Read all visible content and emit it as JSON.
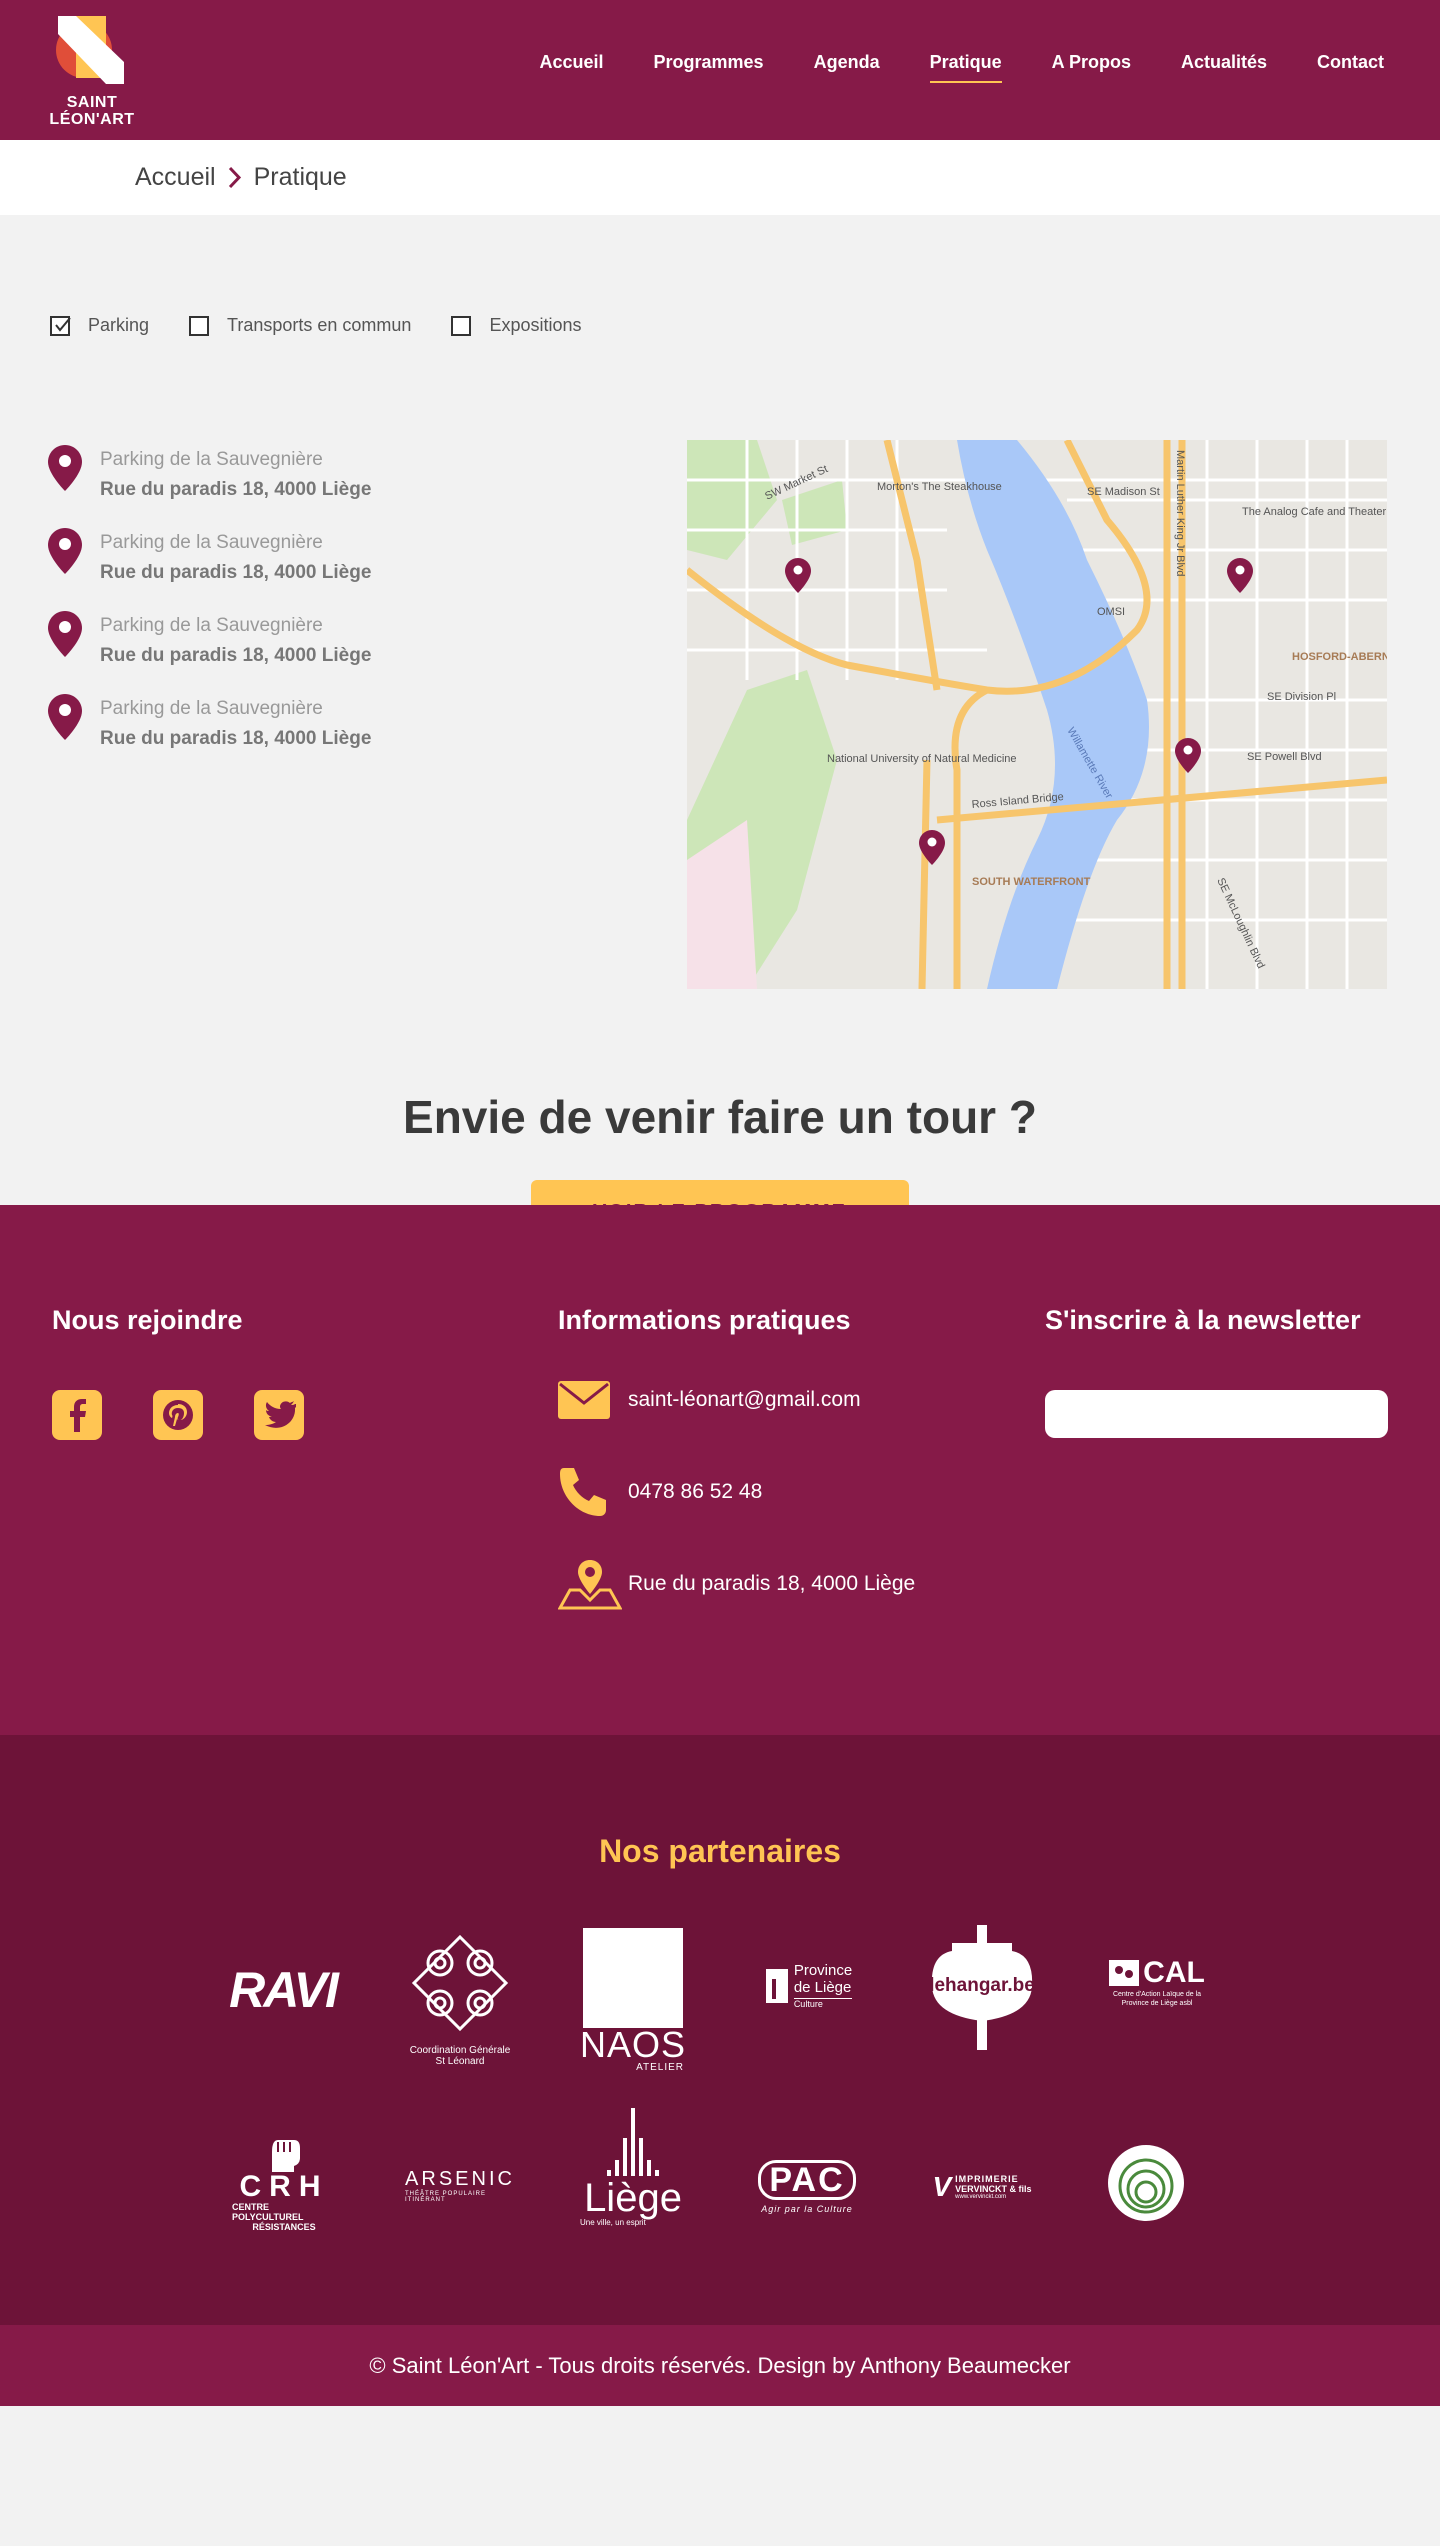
{
  "header": {
    "logo_text_line1": "SAINT",
    "logo_text_line2": "LÉON'ART",
    "nav": [
      {
        "label": "Accueil",
        "active": false
      },
      {
        "label": "Programmes",
        "active": false
      },
      {
        "label": "Agenda",
        "active": false
      },
      {
        "label": "Pratique",
        "active": true
      },
      {
        "label": "A Propos",
        "active": false
      },
      {
        "label": "Actualités",
        "active": false
      },
      {
        "label": "Contact",
        "active": false
      }
    ]
  },
  "breadcrumb": {
    "home": "Accueil",
    "current": "Pratique"
  },
  "filters": [
    {
      "label": "Parking",
      "checked": true
    },
    {
      "label": "Transports en commun",
      "checked": false
    },
    {
      "label": "Expositions",
      "checked": false
    }
  ],
  "parkings": [
    {
      "name": "Parking de la Sauvegnière",
      "address": "Rue du paradis 18, 4000 Liège"
    },
    {
      "name": "Parking de la Sauvegnière",
      "address": "Rue du paradis 18, 4000 Liège"
    },
    {
      "name": "Parking de la Sauvegnière",
      "address": "Rue du paradis 18, 4000 Liège"
    },
    {
      "name": "Parking de la Sauvegnière",
      "address": "Rue du paradis 18, 4000 Liège"
    }
  ],
  "map": {
    "labels": {
      "steakhouse": "Morton's The Steakhouse",
      "analog": "The Analog Cafe and Theater",
      "omsi": "OMSI",
      "hosford": "HOSFORD-ABERNETHY",
      "medicine": "National University of Natural Medicine",
      "south_waterfront": "SOUTH WATERFRONT",
      "ross_bridge": "Ross Island Bridge",
      "market_st": "SW Market St",
      "madison": "SE Madison St",
      "division": "SE Division Pl",
      "powell": "SE Powell Blvd",
      "mlk": "Martin Luther King Jr Blvd",
      "mcloughlin": "SE McLoughlin Blvd",
      "river": "Willamette River"
    }
  },
  "cta": {
    "title": "Envie de venir faire un tour ?",
    "button": "VOIR LE PROGRAMME"
  },
  "footer": {
    "join_title": "Nous rejoindre",
    "info_title": "Informations pratiques",
    "newsletter_title": "S'inscrire à la newsletter",
    "email": "saint-léonart@gmail.com",
    "phone": "0478 86 52 48",
    "address": "Rue du paradis 18, 4000 Liège",
    "newsletter_placeholder": ""
  },
  "partners": {
    "title": "Nos partenaires",
    "logos": {
      "ravi": "RAVI",
      "coord_line1": "Coordination Générale",
      "coord_line2": "St Léonard",
      "naos": "NAOS",
      "naos_sub": "ATELIER",
      "province_line1": "Province",
      "province_line2": "de Liège",
      "province_sub": "Culture",
      "hangar": "lehangar.be",
      "cal": "CAL",
      "cal_sub": "Centre d'Action Laïque de la Province de Liège asbl",
      "crh": "CRH",
      "crh_sub_line1": "CENTRE POLYCULTUREL",
      "crh_sub_line2": "RÉSISTANCES",
      "arsenic": "ARSENIC",
      "arsenic_sub": "THÉÂTRE POPULAIRE ITINÉRANT",
      "liege": "Liège",
      "liege_sub": "Une ville, un esprit",
      "pac": "PAC",
      "pac_sub": "Agir par la Culture",
      "imprimerie_line1": "IMPRIMERIE",
      "imprimerie_line2": "VERVINCKT & fils",
      "imprimerie_line3": "www.vervinckt.com"
    }
  },
  "copyright": "© Saint Léon'Art - Tous droits réservés. Design by Anthony Beaumecker",
  "colors": {
    "brand": "#861a48",
    "brand_dark": "#6d1338",
    "accent": "#ffc553"
  }
}
